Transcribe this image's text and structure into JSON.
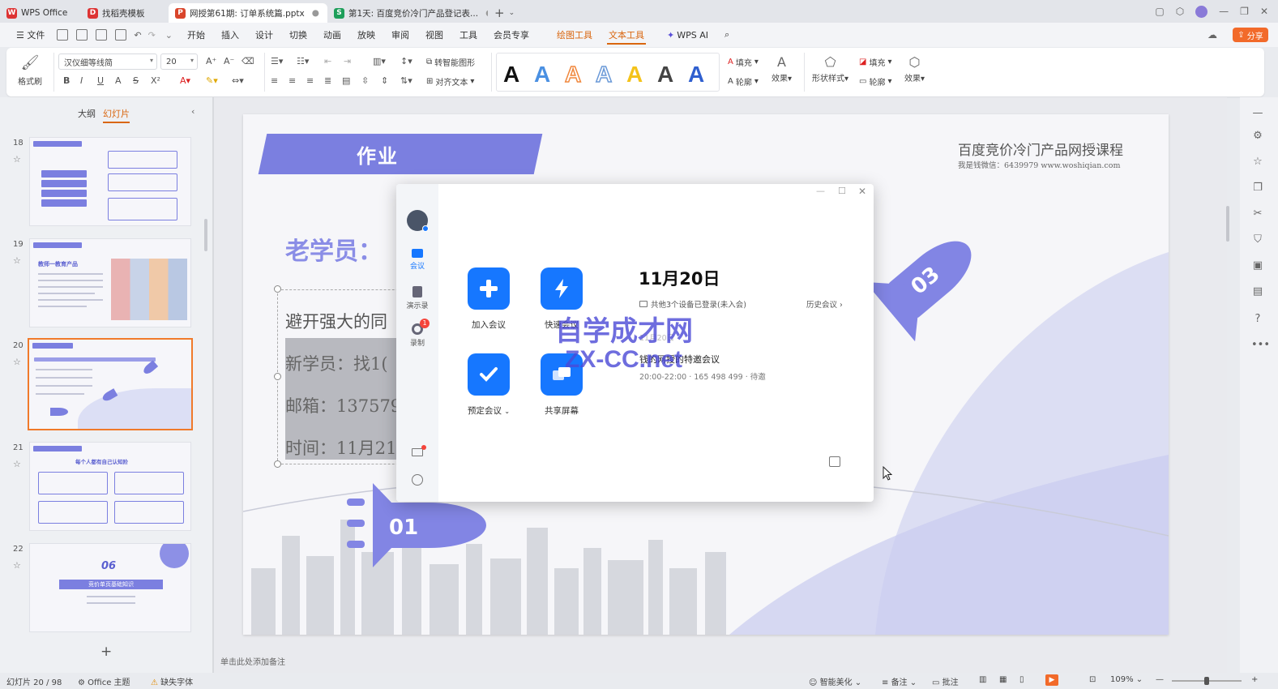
{
  "tabs": [
    {
      "label": "WPS Office",
      "icon": "wps-logo-icon",
      "color": "#d33"
    },
    {
      "label": "找稻壳模板",
      "icon": "docer-icon",
      "color": "#d33"
    },
    {
      "label": "网授第61期: 订单系统篇.pptx",
      "icon": "ppt-file-icon",
      "color": "#d9452b",
      "active": true
    },
    {
      "label": "第1天: 百度竞价冷门产品登记表...",
      "icon": "sheet-file-icon",
      "color": "#1d9e5a"
    }
  ],
  "menu": {
    "file": "文件",
    "items": [
      "开始",
      "插入",
      "设计",
      "切换",
      "动画",
      "放映",
      "审阅",
      "视图",
      "工具",
      "会员专享"
    ],
    "drawing_tools": "绘图工具",
    "text_tools": "文本工具",
    "wps_ai": "WPS AI",
    "share": "分享"
  },
  "ribbon": {
    "format_painter": "格式刷",
    "font_name": "汉仪细等线简",
    "font_size": "20",
    "smart_shape": "转智能图形",
    "align_text": "对齐文本",
    "fill": "填充",
    "outline": "轮廓",
    "effect": "效果",
    "shape_style": "形状样式",
    "fill2": "填充",
    "outline2": "轮廓",
    "effect2": "效果",
    "wordart_glyph": "A"
  },
  "left_pane": {
    "tab_outline": "大纲",
    "tab_slides": "幻灯片",
    "slides": [
      {
        "num": "18"
      },
      {
        "num": "19",
        "title": "教师一教育产品"
      },
      {
        "num": "20",
        "selected": true
      },
      {
        "num": "21",
        "title": "每个人都有自己认知阶"
      },
      {
        "num": "22",
        "title": "06",
        "subtitle": "竞价单页基础知识"
      }
    ],
    "add": "+"
  },
  "slide": {
    "banner": "作业",
    "course_title": "百度竞价冷门产品网授课程",
    "course_sub": "我是钱微信：6439979  www.woshiqian.com",
    "old_student": "老学员：",
    "line1": "避开强大的同",
    "line2": "新学员：找1(",
    "line3": "邮箱：137579",
    "line4": "时间：11月21",
    "rocket1": "01",
    "rocket3": "03"
  },
  "dialog": {
    "side_meeting": "会议",
    "side_record_book": "演示录",
    "side_record": "录制",
    "record_badge": "1",
    "join": "加入会议",
    "quick": "快速会议",
    "schedule": "预定会议",
    "share_screen": "共享屏幕",
    "date": "11月20日",
    "devices": "共他3个设备已登录(未入会)",
    "history": "历史会议",
    "meeting_date": "11月20日",
    "meeting_title": "钱的网授的特邀会议",
    "meeting_info": "20:00-22:00 · 165 498 499 · 待邀"
  },
  "watermark": {
    "line1": "自学成才网",
    "line2": "ZX-CC.net"
  },
  "notes_placeholder": "单击此处添加备注",
  "status": {
    "slide_count": "幻灯片 20 / 98",
    "theme": "Office 主题",
    "missing_font": "缺失字体",
    "beautify": "智能美化",
    "notes": "备注",
    "comment": "批注",
    "zoom": "109%"
  },
  "colors": {
    "accent_purple": "#7b7fe0",
    "meeting_blue": "#1677ff",
    "wps_orange": "#f26a2a"
  }
}
